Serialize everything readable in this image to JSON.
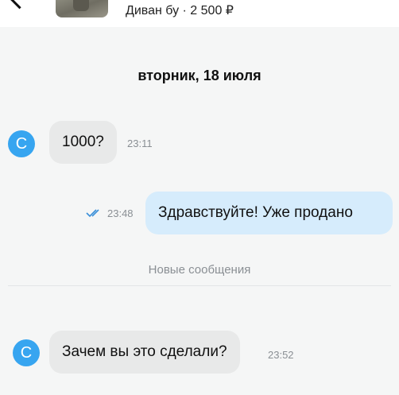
{
  "header": {
    "listing_title": "Диван бу · 2 500 ₽"
  },
  "chat": {
    "date_divider": "вторник, 18 июля",
    "new_messages_divider": "Новые сообщения",
    "messages": [
      {
        "direction": "incoming",
        "avatar_letter": "С",
        "text": "1000?",
        "time": "23:11"
      },
      {
        "direction": "outgoing",
        "status": "read",
        "text": "Здравствуйте! Уже продано",
        "time": "23:48"
      },
      {
        "direction": "incoming",
        "avatar_letter": "С",
        "text": "Зачем вы это сделали?",
        "time": "23:52"
      }
    ]
  },
  "colors": {
    "avatar": "#37a5f0",
    "incoming_bubble": "#e8e9e9",
    "outgoing_bubble": "#d6ecfc",
    "read_check": "#3a8fd8"
  },
  "icons": {
    "back": "back-arrow-icon",
    "read_status": "double-check-icon"
  }
}
